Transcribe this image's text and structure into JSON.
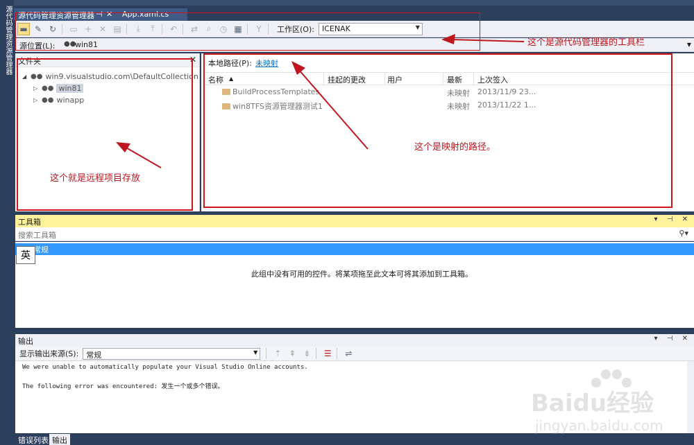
{
  "side_tab": {
    "label": "源代码管理资源管理器"
  },
  "doc_tabs": [
    {
      "label": "源代码管理资源管理器",
      "pin": "⊣",
      "close": "✕"
    },
    {
      "label": "App.xaml.cs"
    }
  ],
  "toolbar": {
    "workspace_label": "工作区(O):",
    "workspace_value": "ICENAK"
  },
  "source_location": {
    "label": "源位置(L):",
    "value": "win81"
  },
  "folders_pane": {
    "title": "文件夹",
    "close": "✕",
    "tree": [
      {
        "label": "win9.visualstudio.com\\DefaultCollection"
      },
      {
        "label": "win81"
      },
      {
        "label": "winapp"
      }
    ]
  },
  "files_pane": {
    "local_path_label": "本地路径(P):",
    "local_path_value": "未映射",
    "columns": [
      "名称",
      "挂起的更改",
      "用户",
      "最新",
      "上次签入"
    ],
    "rows": [
      {
        "name": "BuildProcessTemplates",
        "latest": "未映射",
        "last_checkin": "2013/11/9 23..."
      },
      {
        "name": "win8TFS资源管理器测试1",
        "latest": "未映射",
        "last_checkin": "2013/11/22 1..."
      }
    ]
  },
  "annotations": {
    "toolbar_note": "这个是源代码管理器的工具栏",
    "path_note": "这个是映射的路径。",
    "remote_note": "这个就是远程项目存放"
  },
  "toolbox": {
    "title": "工具箱",
    "controls": "▾ ⊣ ✕",
    "search_placeholder": "搜索工具箱",
    "group_label": "常规",
    "ime_label": "英",
    "empty_message": "此组中没有可用的控件。将某项拖至此文本可将其添加到工具箱。"
  },
  "output": {
    "title": "输出",
    "controls": "▾ ⊣ ✕",
    "source_label": "显示输出来源(S):",
    "source_value": "常规",
    "lines": [
      "We were unable to automatically populate your Visual Studio Online accounts.",
      "The following error was encountered: 发生一个或多个错误。"
    ]
  },
  "bottom_tabs": [
    "错误列表",
    "输出"
  ],
  "watermark": {
    "text": "Baidu经验",
    "url": "jingyan.baidu.com"
  },
  "colors": {
    "accent": "#3399ff",
    "annotation": "#d0151d",
    "toolbox_header": "#fff29d"
  }
}
